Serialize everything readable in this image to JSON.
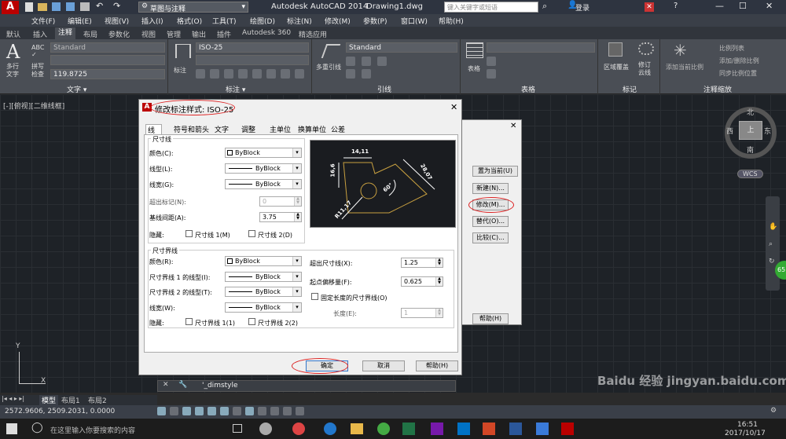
{
  "title_bar": {
    "workspace": "草图与注释",
    "app_title": "Autodesk AutoCAD 2014",
    "doc_title": "Drawing1.dwg",
    "search_placeholder": "键入关键字或短语",
    "login": "登录"
  },
  "menu": [
    "文件(F)",
    "编辑(E)",
    "视图(V)",
    "插入(I)",
    "格式(O)",
    "工具(T)",
    "绘图(D)",
    "标注(N)",
    "修改(M)",
    "参数(P)",
    "窗口(W)",
    "帮助(H)"
  ],
  "ribbon_tabs": [
    "默认",
    "插入",
    "注释",
    "布局",
    "参数化",
    "视图",
    "管理",
    "输出",
    "插件",
    "Autodesk 360",
    "精选应用"
  ],
  "ribbon": {
    "text_panel": {
      "multiline": "多行\n文字",
      "spell": "拼写\n检查",
      "style": "Standard",
      "height": "119.8725",
      "label": "文字 ▾"
    },
    "dim_panel": {
      "dim": "标注",
      "style": "ISO-25",
      "label": "标注 ▾"
    },
    "leader_panel": {
      "multileader": "多重引线",
      "style": "Standard",
      "label": "引线"
    },
    "table_panel": {
      "table": "表格",
      "label": "表格"
    },
    "markup_panel": {
      "area": "区域覆盖",
      "revcloud": "修订\n云线",
      "label": "标记"
    },
    "scale_panel": {
      "add_scale": "添加当前比例",
      "scale_list": "比例列表",
      "add_delete": "添加/删除比例",
      "sync": "同步比例位置",
      "label": "注释缩放"
    }
  },
  "viewport": {
    "label": "[-][俯视][二维线框]",
    "compass": {
      "north": "北",
      "south": "南",
      "east": "东",
      "west": "西",
      "top": "上"
    },
    "wcs": "WCS",
    "badge": "65"
  },
  "dialog": {
    "title": "修改标注样式: ISO-25",
    "tabs": [
      "线",
      "符号和箭头",
      "文字",
      "调整",
      "主单位",
      "换算单位",
      "公差"
    ],
    "dim_lines": {
      "group": "尺寸线",
      "color_label": "颜色(C):",
      "color": "ByBlock",
      "linetype_label": "线型(L):",
      "linetype": "ByBlock",
      "lineweight_label": "线宽(G):",
      "lineweight": "ByBlock",
      "extend_label": "超出标记(N):",
      "extend": "0",
      "baseline_label": "基线间距(A):",
      "baseline": "3.75",
      "suppress_label": "隐藏:",
      "sup1": "尺寸线 1(M)",
      "sup2": "尺寸线 2(D)"
    },
    "ext_lines": {
      "group": "尺寸界线",
      "color_label": "颜色(R):",
      "color": "ByBlock",
      "lt1_label": "尺寸界线 1 的线型(I):",
      "lt1": "ByBlock",
      "lt2_label": "尺寸界线 2 的线型(T):",
      "lt2": "ByBlock",
      "lw_label": "线宽(W):",
      "lw": "ByBlock",
      "suppress_label": "隐藏:",
      "sup1": "尺寸界线 1(1)",
      "sup2": "尺寸界线 2(2)",
      "beyond_label": "超出尺寸线(X):",
      "beyond": "1.25",
      "offset_label": "起点偏移量(F):",
      "offset": "0.625",
      "fixed_label": "固定长度的尺寸界线(O)",
      "length_label": "长度(E):",
      "length": "1"
    },
    "preview": {
      "d1": "14,11",
      "d2": "16,6",
      "d3": "28,07",
      "d4": "60°",
      "d5": "R11,17"
    },
    "ok": "确定",
    "cancel": "取消",
    "help": "帮助(H)"
  },
  "bg_dialog": {
    "set_current": "置为当前(U)",
    "new": "新建(N)...",
    "modify": "修改(M)...",
    "override": "替代(O)...",
    "compare": "比较(C)...",
    "help": "帮助(H)"
  },
  "command_line": "'_dimstyle",
  "layout_tabs": [
    "模型",
    "布局1",
    "布局2"
  ],
  "coords": "2572.9606, 2509.2031, 0.0000",
  "taskbar": {
    "search": "在这里输入你要搜索的内容",
    "time": "16:51",
    "date": "2017/10/17"
  },
  "watermark": "Baidu 经验 jingyan.baidu.com"
}
